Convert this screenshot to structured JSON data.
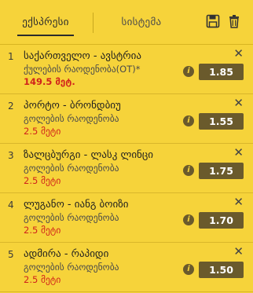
{
  "tabs": {
    "express": "ექსპრესი",
    "system": "სისტემა"
  },
  "icons": {
    "save": "save-icon",
    "trash": "trash-icon",
    "close": "close-icon",
    "info": "info-icon"
  },
  "bets": [
    {
      "num": "1",
      "match": "საქართველო - ავსტრია",
      "market": "ქულების რაოდენობა(OT)*",
      "line": "149.5 მეტ.",
      "odds": "1.85"
    },
    {
      "num": "2",
      "match": "პორტო - ბრონდბიუ",
      "market": "გოლების რაოდენობა",
      "line": "2.5 მეტი",
      "odds": "1.55"
    },
    {
      "num": "3",
      "match": "ზალცბურგი - ლასკ ლინცი",
      "market": "გოლების რაოდენობა",
      "line": "2.5 მეტი",
      "odds": "1.75"
    },
    {
      "num": "4",
      "match": "ლუგანო - იანგ ბოიზი",
      "market": "გოლების რაოდენობა",
      "line": "2.5 მეტი",
      "odds": "1.70"
    },
    {
      "num": "5",
      "match": "ადმირა - რაპიდი",
      "market": "გოლების რაოდენობა",
      "line": "2.5 მეტი",
      "odds": "1.50"
    }
  ]
}
